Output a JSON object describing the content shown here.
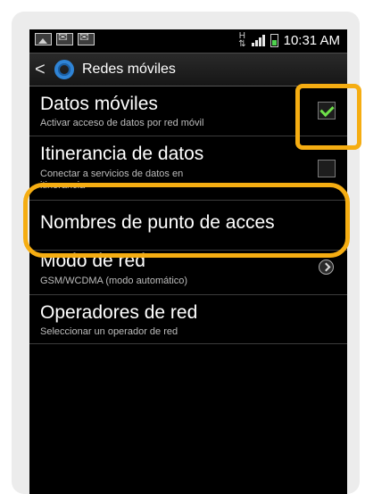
{
  "status_bar": {
    "time": "10:31 AM",
    "network": "H"
  },
  "title_bar": {
    "title": "Redes móviles"
  },
  "settings": [
    {
      "title": "Datos móviles",
      "subtitle": "Activar acceso de datos por red móvil",
      "control": "checkbox",
      "checked": true
    },
    {
      "title": "Itinerancia de datos",
      "subtitle_line1": "Conectar a servicios de datos en",
      "subtitle_line2": "itinerancia",
      "control": "checkbox",
      "checked": false
    },
    {
      "title": "Nombres de punto de acces"
    },
    {
      "title": "Modo de red",
      "subtitle": "GSM/WCDMA (modo automático)",
      "control": "arrow"
    },
    {
      "title": "Operadores de red",
      "subtitle": "Seleccionar un operador de red"
    }
  ],
  "colors": {
    "highlight": "#f5ad12",
    "check": "#6fe04a",
    "accent": "#2f84d6"
  }
}
